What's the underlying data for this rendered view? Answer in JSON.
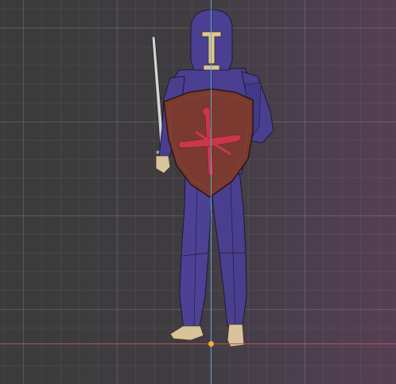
{
  "viewport": {
    "type": "3d-viewport",
    "model": "knight-figure",
    "view": "front-orthographic",
    "grid": true,
    "colors": {
      "background": "#3b3b3b",
      "grid": "#505050",
      "y_axis": "#5aa8c8",
      "x_axis": "#c0505a",
      "origin": "#f0b030",
      "armor": "#4a3f8c",
      "shield": "#7a3a30",
      "emblem": "#c8384a",
      "skin": "#d8c49a"
    }
  }
}
